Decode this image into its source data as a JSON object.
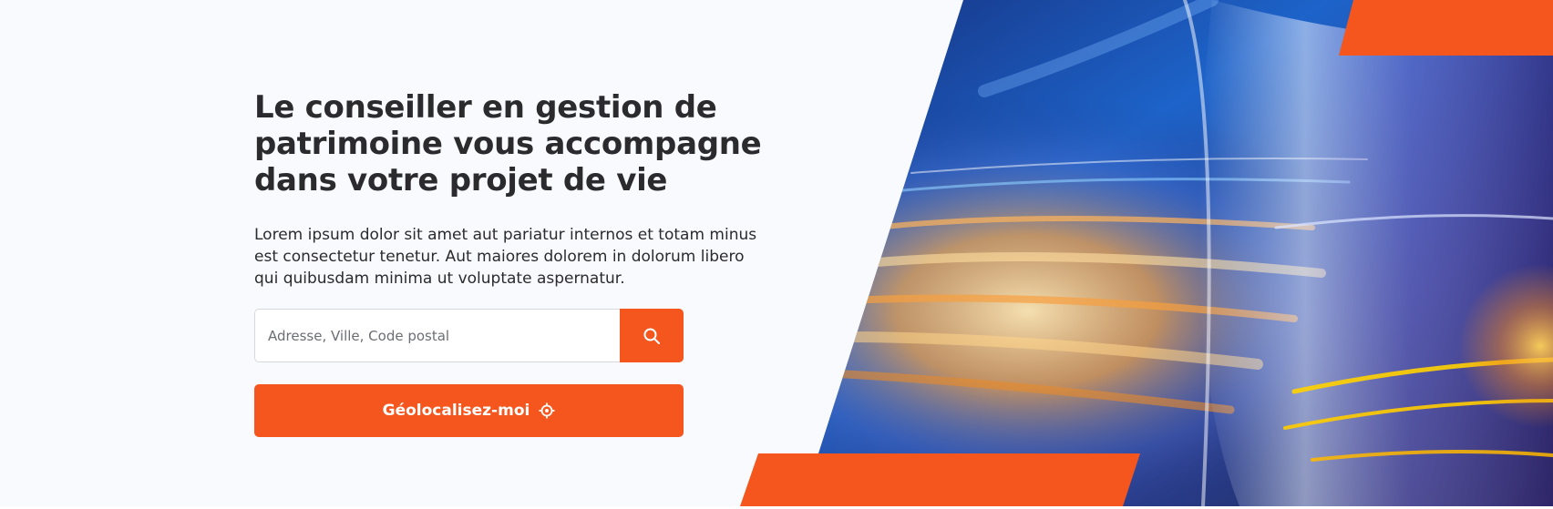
{
  "hero": {
    "title": "Le conseiller en gestion de\npatrimoine vous accompagne\ndans votre projet de vie",
    "description": "Lorem ipsum dolor sit amet aut pariatur internos et totam minus est consectetur tenetur. Aut maiores dolorem in dolorum libero qui quibusdam minima ut voluptate aspernatur."
  },
  "search": {
    "placeholder": "Adresse, Ville, Code postal",
    "value": "",
    "icon": "search-icon"
  },
  "geolocate": {
    "label": "Géolocalisez-moi",
    "icon": "crosshair-icon"
  },
  "colors": {
    "accent": "#f4561e",
    "text": "#2b2b2d",
    "background": "#f9fafd"
  }
}
